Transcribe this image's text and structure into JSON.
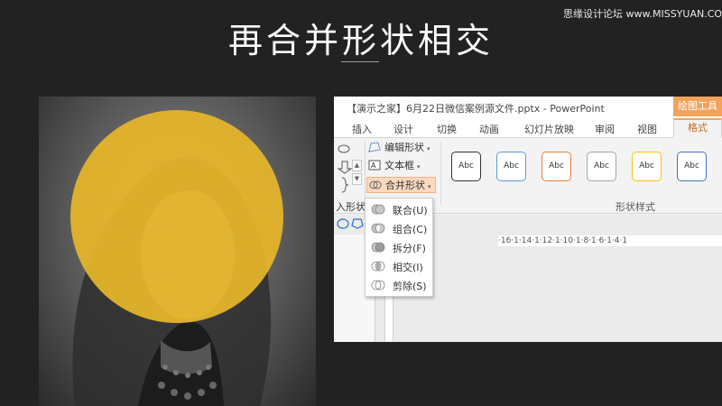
{
  "slide": {
    "title": "再合并形状相交",
    "watermark": "思缘设计论坛 www.MISSYUAN.COM"
  },
  "ppt": {
    "window_title": "【演示之家】6月22日微信案例源文件.pptx - PowerPoint",
    "contextual_tab": "绘图工具",
    "tabs": [
      "插入",
      "设计",
      "切换",
      "动画",
      "幻灯片放映",
      "审阅",
      "视图"
    ],
    "active_tab": "格式",
    "ribbon": {
      "edit_shape": "编辑形状",
      "text_box": "文本框",
      "merge_shapes": "合并形状",
      "insert_shapes_group": "入形状",
      "shape_styles_group": "形状样式",
      "style_sample": "Abc",
      "style_colors": [
        "#333333",
        "#5b9bd5",
        "#ed7d31",
        "#a5a5a5",
        "#ffc000",
        "#4472c4"
      ]
    },
    "ruler": "·16·1·14·1·12·1·10·1·8·1·6·1·4·1",
    "merge_menu": [
      {
        "label": "联合(U)",
        "icon": "union-icon"
      },
      {
        "label": "组合(C)",
        "icon": "combine-icon"
      },
      {
        "label": "拆分(F)",
        "icon": "fragment-icon"
      },
      {
        "label": "相交(I)",
        "icon": "intersect-icon"
      },
      {
        "label": "剪除(S)",
        "icon": "subtract-icon"
      }
    ]
  },
  "colors": {
    "background": "#222222",
    "circle": "#e6b62a",
    "accent": "#f3a25a"
  }
}
